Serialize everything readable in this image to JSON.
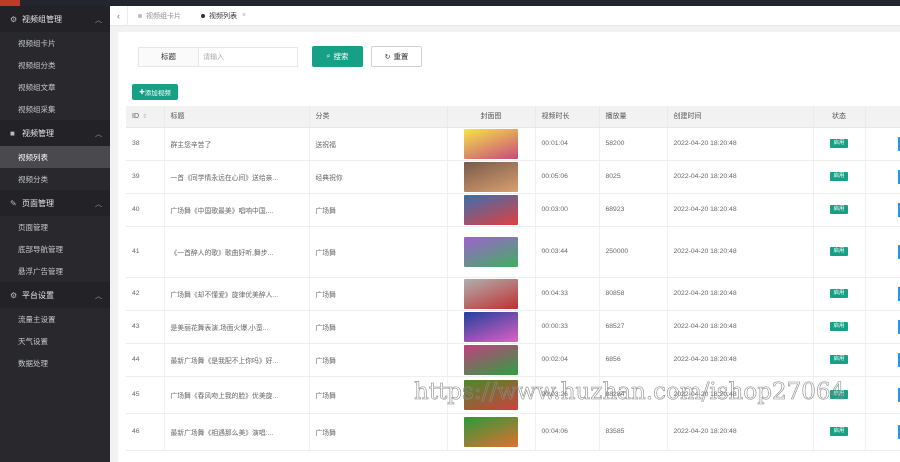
{
  "sidebar": {
    "groups": [
      {
        "icon": "gear-icon",
        "glyph": "⚙",
        "label": "视频组管理",
        "items": [
          "视频组卡片",
          "视频组分类",
          "视频组文章",
          "视频组采集"
        ]
      },
      {
        "icon": "video-icon",
        "glyph": "■",
        "label": "视频管理",
        "items": [
          "视频列表",
          "视频分类"
        ]
      },
      {
        "icon": "wrench-icon",
        "glyph": "✎",
        "label": "页面管理",
        "items": [
          "页面管理",
          "底部导航管理",
          "悬浮广告管理"
        ]
      },
      {
        "icon": "gear-icon",
        "glyph": "⚙",
        "label": "平台设置",
        "items": [
          "流量主设置",
          "天气设置",
          "数据处理"
        ]
      }
    ],
    "active_item": "视频列表"
  },
  "tabs": {
    "back": "‹",
    "items": [
      {
        "label": "视频组卡片",
        "active": false
      },
      {
        "label": "视频列表",
        "active": true,
        "close": "×"
      }
    ]
  },
  "search": {
    "label": "标题",
    "placeholder": "请输入",
    "search_label": "搜索",
    "reset_label": "重置"
  },
  "add_label": "添加视频",
  "table": {
    "headers": [
      "ID",
      "标题",
      "分类",
      "封面图",
      "视频时长",
      "播放量",
      "创建时间",
      "状态"
    ],
    "rows": [
      {
        "id": "38",
        "title": "群主您辛苦了",
        "category": "送祝福",
        "duration": "00:01:04",
        "plays": "58200",
        "created": "2022-04-20 18:20:48",
        "status": "启用",
        "thumb": [
          "#f5e44a",
          "#c94a7a"
        ]
      },
      {
        "id": "39",
        "title": "一首《同学情永远在心间》送给亲...",
        "category": "经典祝你",
        "duration": "00:05:06",
        "plays": "8025",
        "created": "2022-04-20 18:20:48",
        "status": "启用",
        "thumb": [
          "#7a5a4a",
          "#d9a070"
        ]
      },
      {
        "id": "40",
        "title": "广场舞《中国歌最美》唱响中国,...",
        "category": "广场舞",
        "duration": "00:03:00",
        "plays": "68923",
        "created": "2022-04-20 18:20:48",
        "status": "启用",
        "thumb": [
          "#3b6fb0",
          "#e04040"
        ]
      },
      {
        "id": "41",
        "title": "《一首醉人的歌》歌曲好听,舞步...",
        "category": "广场舞",
        "duration": "00:03:44",
        "plays": "250000",
        "created": "2022-04-20 18:20:48",
        "status": "启用",
        "thumb": [
          "#a060d0",
          "#40b060"
        ]
      },
      {
        "id": "42",
        "title": "广场舞《却不懂爱》旋律优美醉人...",
        "category": "广场舞",
        "duration": "00:04:33",
        "plays": "80858",
        "created": "2022-04-20 18:20:48",
        "status": "启用",
        "thumb": [
          "#b0b0b0",
          "#c03030"
        ]
      },
      {
        "id": "43",
        "title": "是美丽花舞表演,场面火爆,小蛮...",
        "category": "广场舞",
        "duration": "00:00:33",
        "plays": "68527",
        "created": "2022-04-20 18:20:48",
        "status": "启用",
        "thumb": [
          "#2040a0",
          "#e060c0"
        ]
      },
      {
        "id": "44",
        "title": "最新广场舞《是我配不上你吗》好...",
        "category": "广场舞",
        "duration": "00:02:04",
        "plays": "6856",
        "created": "2022-04-20 18:20:48",
        "status": "启用",
        "thumb": [
          "#c04080",
          "#30a040"
        ]
      },
      {
        "id": "45",
        "title": "广场舞《春风吻上我的脸》优美旋...",
        "category": "广场舞",
        "duration": "00:03:26",
        "plays": "88284",
        "created": "2022-04-20 18:20:48",
        "status": "启用",
        "thumb": [
          "#4a8a2a",
          "#d04040"
        ]
      },
      {
        "id": "46",
        "title": "最新广场舞《相遇那么美》演唱:...",
        "category": "广场舞",
        "duration": "00:04:06",
        "plays": "83585",
        "created": "2022-04-20 18:20:48",
        "status": "启用",
        "thumb": [
          "#2a9a3a",
          "#e07030"
        ]
      }
    ]
  },
  "watermark": "https://www.huzhan.com/ishop27064",
  "colors": {
    "accent": "#16a085",
    "sidebar": "#28282d",
    "op_button": "#2196f3"
  }
}
